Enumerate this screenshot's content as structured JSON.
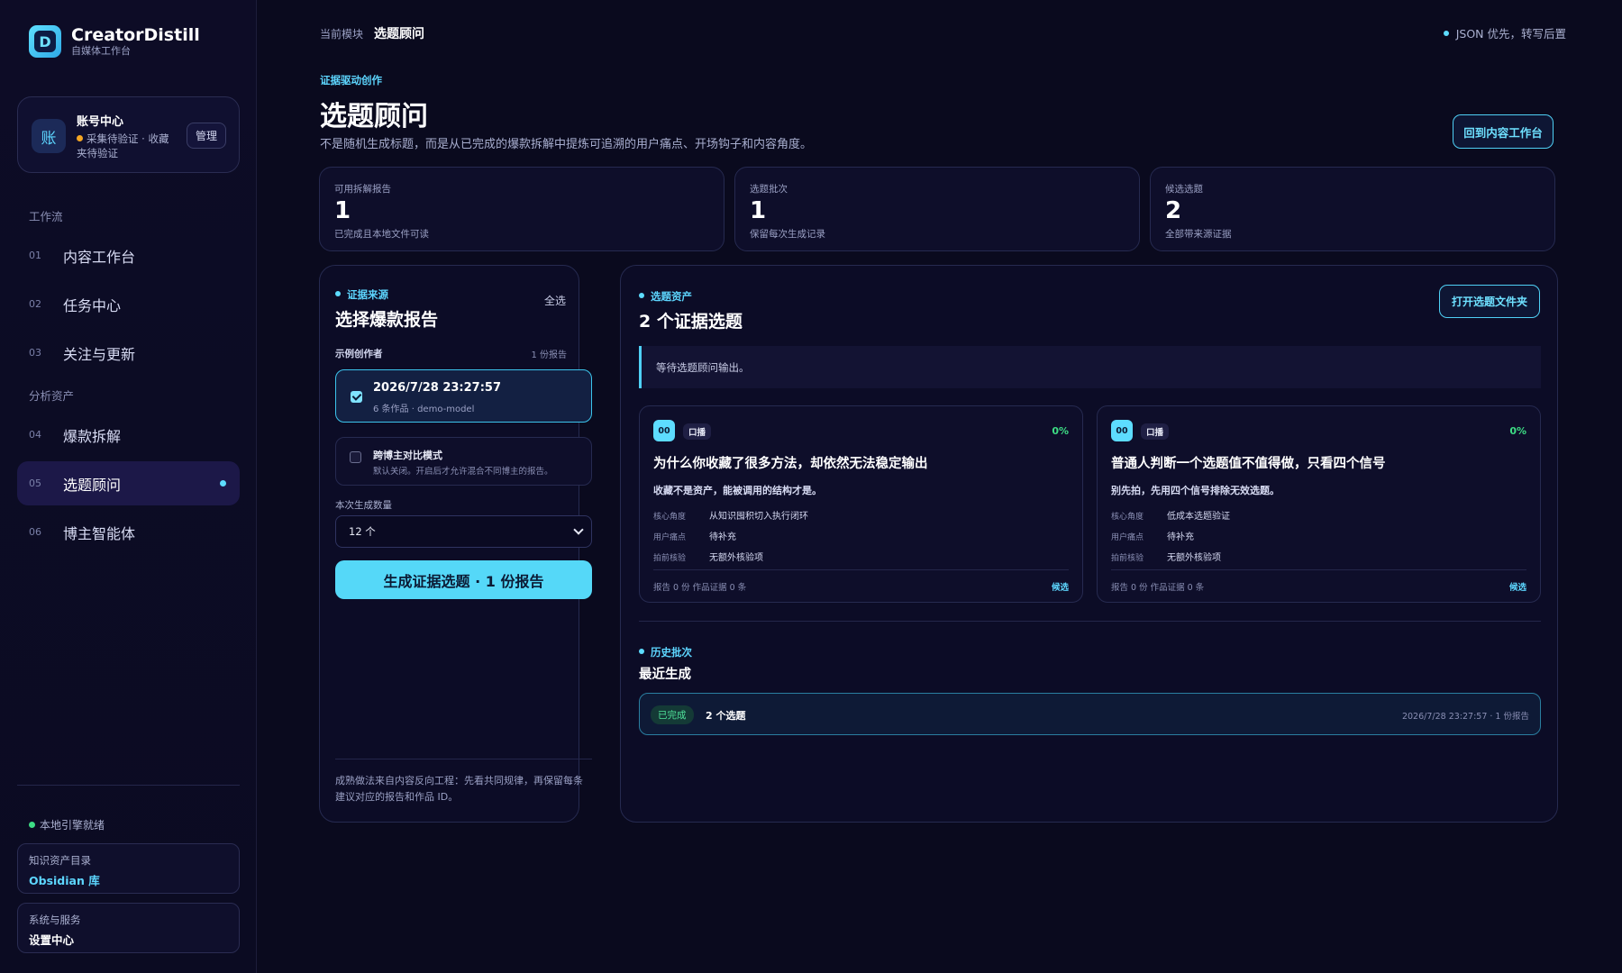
{
  "brand": {
    "logo_letter": "D",
    "name": "CreatorDistill",
    "subtitle": "自媒体工作台"
  },
  "account": {
    "avatar": "账",
    "title": "账号中心",
    "status": "采集待验证 · 收藏夹待验证",
    "manage_label": "管理"
  },
  "nav": {
    "group_workflow": "工作流",
    "group_assets": "分析资产",
    "items": [
      {
        "num": "01",
        "label": "内容工作台"
      },
      {
        "num": "02",
        "label": "任务中心"
      },
      {
        "num": "03",
        "label": "关注与更新"
      },
      {
        "num": "04",
        "label": "爆款拆解"
      },
      {
        "num": "05",
        "label": "选题顾问"
      },
      {
        "num": "06",
        "label": "博主智能体"
      }
    ]
  },
  "sidebar_footer": {
    "engine": "本地引擎就绪",
    "knowledge": {
      "title": "知识资产目录",
      "value": "Obsidian 库"
    },
    "system": {
      "title": "系统与服务",
      "value": "设置中心"
    }
  },
  "topbar": {
    "module_label": "当前模块",
    "module_value": "选题顾问",
    "right_text": "JSON 优先，转写后置"
  },
  "header": {
    "eyebrow": "证据驱动创作",
    "title": "选题顾问",
    "description": "不是随机生成标题，而是从已完成的爆款拆解中提炼可追溯的用户痛点、开场钩子和内容角度。",
    "back_button": "回到内容工作台"
  },
  "stats": [
    {
      "label": "可用拆解报告",
      "value": "1",
      "desc": "已完成且本地文件可读"
    },
    {
      "label": "选题批次",
      "value": "1",
      "desc": "保留每次生成记录"
    },
    {
      "label": "候选选题",
      "value": "2",
      "desc": "全部带来源证据"
    }
  ],
  "source_panel": {
    "eyebrow": "证据来源",
    "select_all": "全选",
    "title": "选择爆款报告",
    "author": "示例创作者",
    "author_count": "1 份报告",
    "report": {
      "title": "2026/7/28 23:27:57",
      "sub": "6 条作品 · demo-model"
    },
    "cross_mode": {
      "title": "跨博主对比模式",
      "sub": "默认关闭。开启后才允许混合不同博主的报告。"
    },
    "qty_label": "本次生成数量",
    "qty_value": "12 个",
    "generate_button": "生成证据选题 · 1 份报告",
    "note": "成熟做法来自内容反向工程：先看共同规律，再保留每条建议对应的报告和作品 ID。"
  },
  "assets_panel": {
    "eyebrow": "选题资产",
    "title": "2 个证据选题",
    "open_button": "打开选题文件夹",
    "waiting": "等待选题顾问输出。",
    "row_labels": [
      "核心角度",
      "用户痛点",
      "拍前核验"
    ],
    "topics": [
      {
        "index": "00",
        "tag": "口播",
        "percent": "0%",
        "title": "为什么你收藏了很多方法，却依然无法稳定输出",
        "hook": "收藏不是资产，能被调用的结构才是。",
        "angle": "从知识囤积切入执行闭环",
        "pain": "待补充",
        "verify": "无额外核验项",
        "footer": "报告 0 份  作品证据 0 条",
        "candidate": "候选"
      },
      {
        "index": "00",
        "tag": "口播",
        "percent": "0%",
        "title": "普通人判断一个选题值不值得做，只看四个信号",
        "hook": "别先拍，先用四个信号排除无效选题。",
        "angle": "低成本选题验证",
        "pain": "待补充",
        "verify": "无额外核验项",
        "footer": "报告 0 份  作品证据 0 条",
        "candidate": "候选"
      }
    ],
    "history": {
      "eyebrow": "历史批次",
      "title": "最近生成",
      "badge": "已完成",
      "count": "2 个选题",
      "meta": "2026/7/28 23:27:57 · 1 份报告"
    }
  },
  "colors": {
    "accent": "#5ddcff",
    "success": "#3ddc84",
    "warning": "#f5a623",
    "background": "#0a0a1e"
  }
}
